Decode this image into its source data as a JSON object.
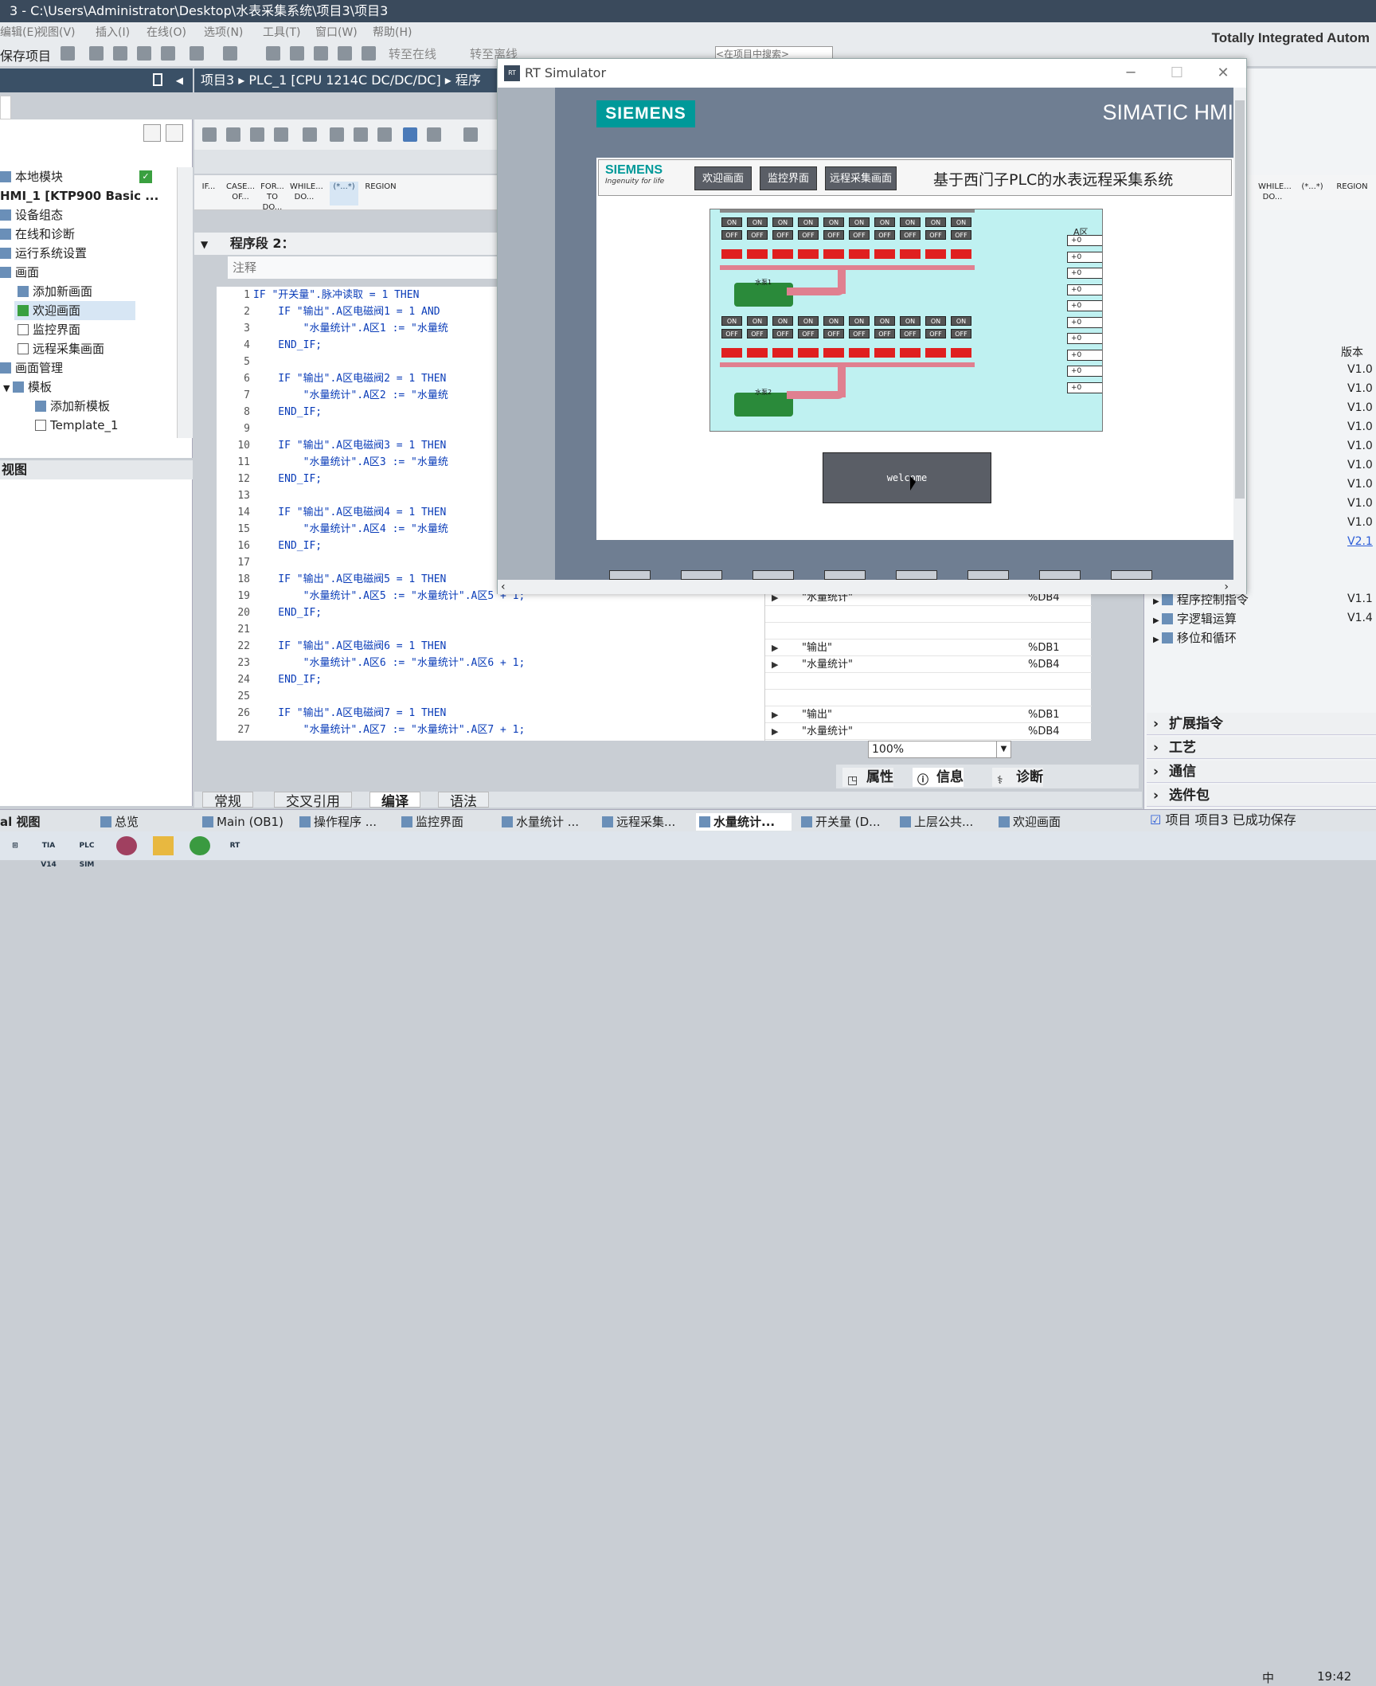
{
  "window": {
    "title": "3  -  C:\\Users\\Administrator\\Desktop\\水表采集系统\\项目3\\项目3"
  },
  "menu": [
    "编辑(E)",
    "视图(V)",
    "插入(I)",
    "在线(O)",
    "选项(N)",
    "工具(T)",
    "窗口(W)",
    "帮助(H)"
  ],
  "toolbar": {
    "save_label": "保存项目",
    "online_label": "转至在线",
    "offline_label": "转至离线",
    "search_placeholder": "<在项目中搜索>"
  },
  "brand": "Totally Integrated Autom",
  "tree": {
    "items": [
      {
        "label": "本地模块"
      },
      {
        "label": "HMI_1 [KTP900 Basic ..."
      },
      {
        "label": "设备组态"
      },
      {
        "label": "在线和诊断"
      },
      {
        "label": "运行系统设置"
      },
      {
        "label": "画面"
      },
      {
        "label": "添加新画面"
      },
      {
        "label": "欢迎画面"
      },
      {
        "label": "监控界面"
      },
      {
        "label": "远程采集画面"
      },
      {
        "label": "画面管理"
      },
      {
        "label": "模板"
      },
      {
        "label": "添加新模板"
      },
      {
        "label": "Template_1"
      }
    ],
    "detail_title": "视图"
  },
  "breadcrumb": "项目3 ▸ PLC_1 [CPU 1214C DC/DC/DC] ▸ 程序",
  "keywords": [
    "IF...",
    "CASE... OF...",
    "FOR... TO DO...",
    "WHILE... DO...",
    "(*...*)",
    "REGION"
  ],
  "keywords_right": [
    "WHILE... DO...",
    "(*...*)",
    "REGION"
  ],
  "segment": {
    "title": "程序段 2：",
    "comment": "注释"
  },
  "code": [
    {
      "n": "1",
      "t": "IF \"开关量\".脉冲读取 = 1 THEN"
    },
    {
      "n": "2",
      "t": "    IF \"输出\".A区电磁阀1 = 1 AND"
    },
    {
      "n": "3",
      "t": "        \"水量统计\".A区1 := \"水量统"
    },
    {
      "n": "4",
      "t": "    END_IF;"
    },
    {
      "n": "5",
      "t": ""
    },
    {
      "n": "6",
      "t": "    IF \"输出\".A区电磁阀2 = 1 THEN"
    },
    {
      "n": "7",
      "t": "        \"水量统计\".A区2 := \"水量统"
    },
    {
      "n": "8",
      "t": "    END_IF;"
    },
    {
      "n": "9",
      "t": ""
    },
    {
      "n": "10",
      "t": "    IF \"输出\".A区电磁阀3 = 1 THEN"
    },
    {
      "n": "11",
      "t": "        \"水量统计\".A区3 := \"水量统"
    },
    {
      "n": "12",
      "t": "    END_IF;"
    },
    {
      "n": "13",
      "t": ""
    },
    {
      "n": "14",
      "t": "    IF \"输出\".A区电磁阀4 = 1 THEN"
    },
    {
      "n": "15",
      "t": "        \"水量统计\".A区4 := \"水量统"
    },
    {
      "n": "16",
      "t": "    END_IF;"
    },
    {
      "n": "17",
      "t": ""
    },
    {
      "n": "18",
      "t": "    IF \"输出\".A区电磁阀5 = 1 THEN"
    },
    {
      "n": "19",
      "t": "        \"水量统计\".A区5 := \"水量统计\".A区5 + 1;"
    },
    {
      "n": "20",
      "t": "    END_IF;"
    },
    {
      "n": "21",
      "t": ""
    },
    {
      "n": "22",
      "t": "    IF \"输出\".A区电磁阀6 = 1 THEN"
    },
    {
      "n": "23",
      "t": "        \"水量统计\".A区6 := \"水量统计\".A区6 + 1;"
    },
    {
      "n": "24",
      "t": "    END_IF;"
    },
    {
      "n": "25",
      "t": ""
    },
    {
      "n": "26",
      "t": "    IF \"输出\".A区电磁阀7 = 1 THEN"
    },
    {
      "n": "27",
      "t": "        \"水量统计\".A区7 := \"水量统计\".A区7 + 1;"
    }
  ],
  "vars": [
    {
      "name": "\"水量统计\"",
      "db": "%DB4"
    },
    {
      "name": "",
      "db": ""
    },
    {
      "name": "",
      "db": ""
    },
    {
      "name": "\"输出\"",
      "db": "%DB1"
    },
    {
      "name": "\"水量统计\"",
      "db": "%DB4"
    },
    {
      "name": "",
      "db": ""
    },
    {
      "name": "",
      "db": ""
    },
    {
      "name": "\"输出\"",
      "db": "%DB1"
    },
    {
      "name": "\"水量统计\"",
      "db": "%DB4"
    }
  ],
  "zoom": "100%",
  "inspector_tabs": [
    "属性",
    "信息",
    "诊断"
  ],
  "bottom_tabs": [
    "常规",
    "交叉引用",
    "编译",
    "语法"
  ],
  "right": {
    "version_header": "版本",
    "versions": [
      "V1.0",
      "V1.0",
      "V1.0",
      "V1.0",
      "V1.0",
      "V1.0",
      "V1.0",
      "V1.0",
      "V1.0",
      "V2.1"
    ],
    "instructions": [
      {
        "label": "程序控制指令",
        "ver": "V1.1"
      },
      {
        "label": "字逻辑运算",
        "ver": "V1.4"
      },
      {
        "label": "移位和循环",
        "ver": ""
      }
    ],
    "sections": [
      "扩展指令",
      "工艺",
      "通信",
      "选件包"
    ]
  },
  "editor_tabs": [
    "总览",
    "Main (OB1)",
    "操作程序 ...",
    "监控界面",
    "水量统计 ...",
    "远程采集...",
    "水量统计...",
    "开关量 (D...",
    "上层公共...",
    "欢迎画面"
  ],
  "editor_tabs_left": "al 视图",
  "status": "项目 项目3 已成功保存",
  "taskbar": [
    "TIA V14",
    "PLC SIM",
    "",
    "",
    "",
    "RT"
  ],
  "ime": "中",
  "clock": "19:42",
  "simulator": {
    "title": "RT Simulator",
    "logo": "SIEMENS",
    "simatic": "SIMATIC HMI",
    "screen_logo": "SIEMENS",
    "tagline": "Ingenuity for life",
    "nav": [
      "欢迎画面",
      "监控界面",
      "远程采集画面"
    ],
    "screen_title": "基于西门子PLC的水表远程采集系统",
    "preview_label": "A区",
    "pump1": "水泵1",
    "pump2": "水泵2",
    "on": "ON",
    "off": "OFF",
    "counter": "+0",
    "welcome": "welcome"
  },
  "colors": {
    "siemens_teal": "#009999",
    "hmi_bg": "#6f7e92",
    "header": "#3a5066"
  }
}
